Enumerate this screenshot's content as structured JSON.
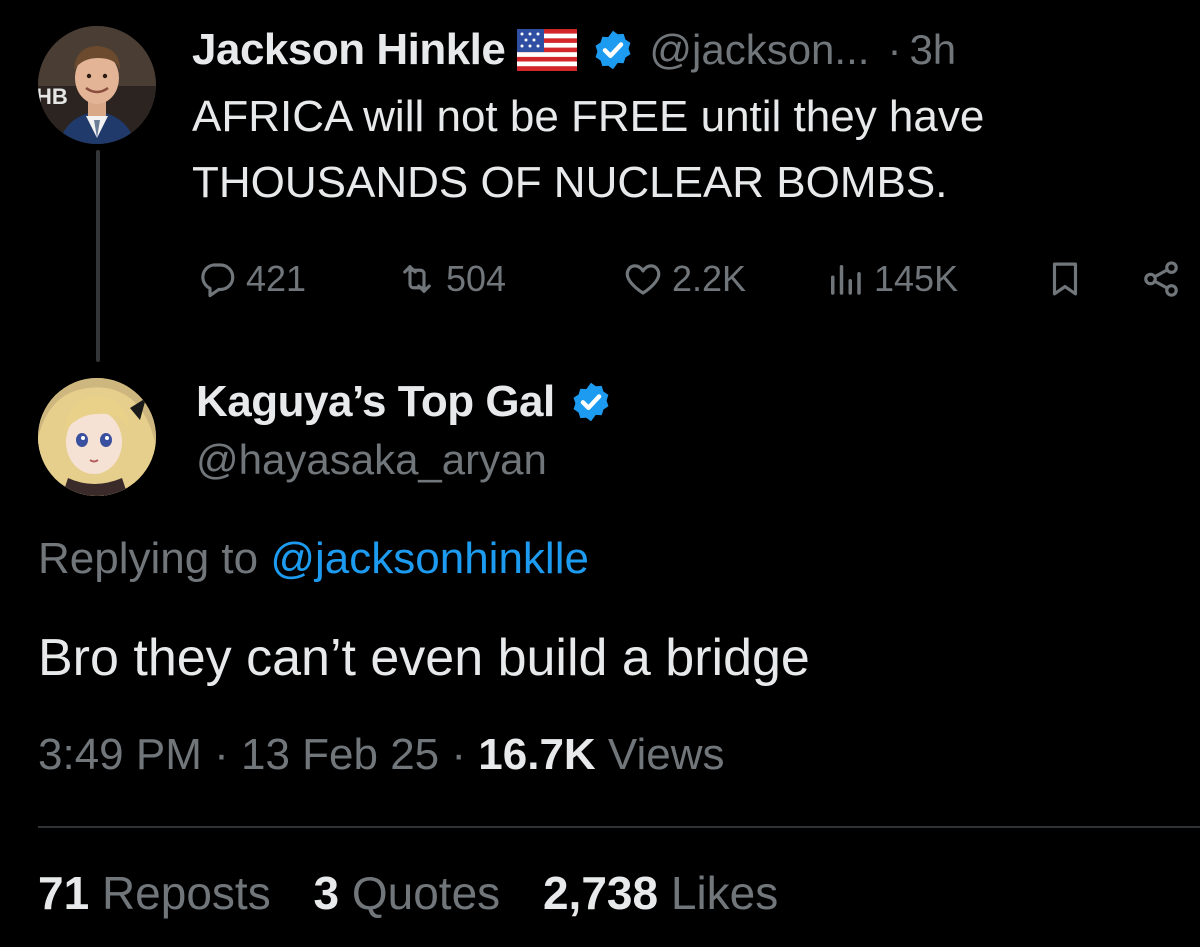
{
  "parent_tweet": {
    "author_name": "Jackson Hinkle",
    "flag_icon": "us-flag-icon",
    "handle": "@jackson...",
    "separator": "·",
    "time": "3h",
    "text": "AFRICA will not be FREE until they have THOUSANDS OF NUCLEAR BOMBS.",
    "avatar_badge": "HB",
    "actions": {
      "replies": "421",
      "reposts": "504",
      "likes": "2.2K",
      "views": "145K"
    }
  },
  "reply_tweet": {
    "author_name": "Kaguya’s Top Gal",
    "handle": "@hayasaka_aryan",
    "replying_prefix": "Replying to ",
    "replying_to": "@jacksonhinklle",
    "text": "Bro they can’t even build a bridge",
    "time": "3:49 PM",
    "separator": "·",
    "date": "13 Feb 25",
    "views_count": "16.7K",
    "views_label": " Views",
    "stats": {
      "reposts_count": "71",
      "reposts_label": " Reposts",
      "quotes_count": "3",
      "quotes_label": " Quotes",
      "likes_count": "2,738",
      "likes_label": " Likes"
    }
  },
  "colors": {
    "background": "#000000",
    "text_primary": "#e7e9ea",
    "text_secondary": "#71767b",
    "accent": "#1d9bf0",
    "divider": "#2f3336"
  }
}
